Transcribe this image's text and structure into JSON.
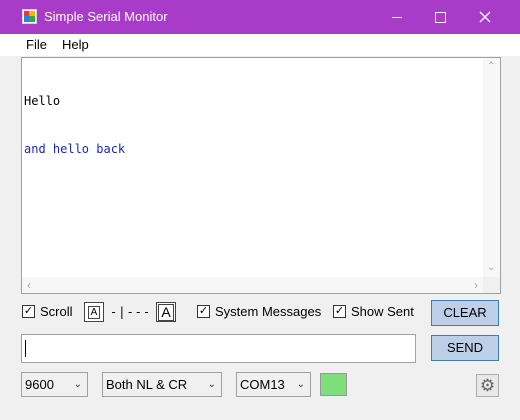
{
  "window": {
    "title": "Simple Serial Monitor",
    "accent_color": "#a83bc8",
    "icons": {
      "app": "app-logo-icon",
      "minimize": "minimize-icon",
      "maximize": "maximize-icon",
      "close": "close-icon"
    }
  },
  "menu": {
    "items": [
      {
        "label": "File"
      },
      {
        "label": "Help"
      }
    ]
  },
  "output": {
    "lines": [
      {
        "text": "Hello",
        "type": "received",
        "color": "#000000"
      },
      {
        "text": "and hello back",
        "type": "sent",
        "color": "#1c28b8"
      }
    ],
    "icons": {
      "up": "chevron-up-icon",
      "down": "chevron-down-icon",
      "left": "chevron-left-icon",
      "right": "chevron-right-icon"
    }
  },
  "controls": {
    "scroll": {
      "label": "Scroll",
      "checked": true
    },
    "font_size": {
      "small_label": "A",
      "large_label": "A",
      "slider_text": "-|---"
    },
    "system_messages": {
      "label": "System Messages",
      "checked": true
    },
    "show_sent": {
      "label": "Show Sent",
      "checked": true
    },
    "checkmark": "✓",
    "clear_label": "CLEAR",
    "send_label": "SEND"
  },
  "send_input": {
    "value": ""
  },
  "footer": {
    "baud": "9600",
    "line_ending": "Both NL & CR",
    "port": "COM13",
    "status_color": "#7ddf7a",
    "settings_icon": "gear-icon"
  }
}
